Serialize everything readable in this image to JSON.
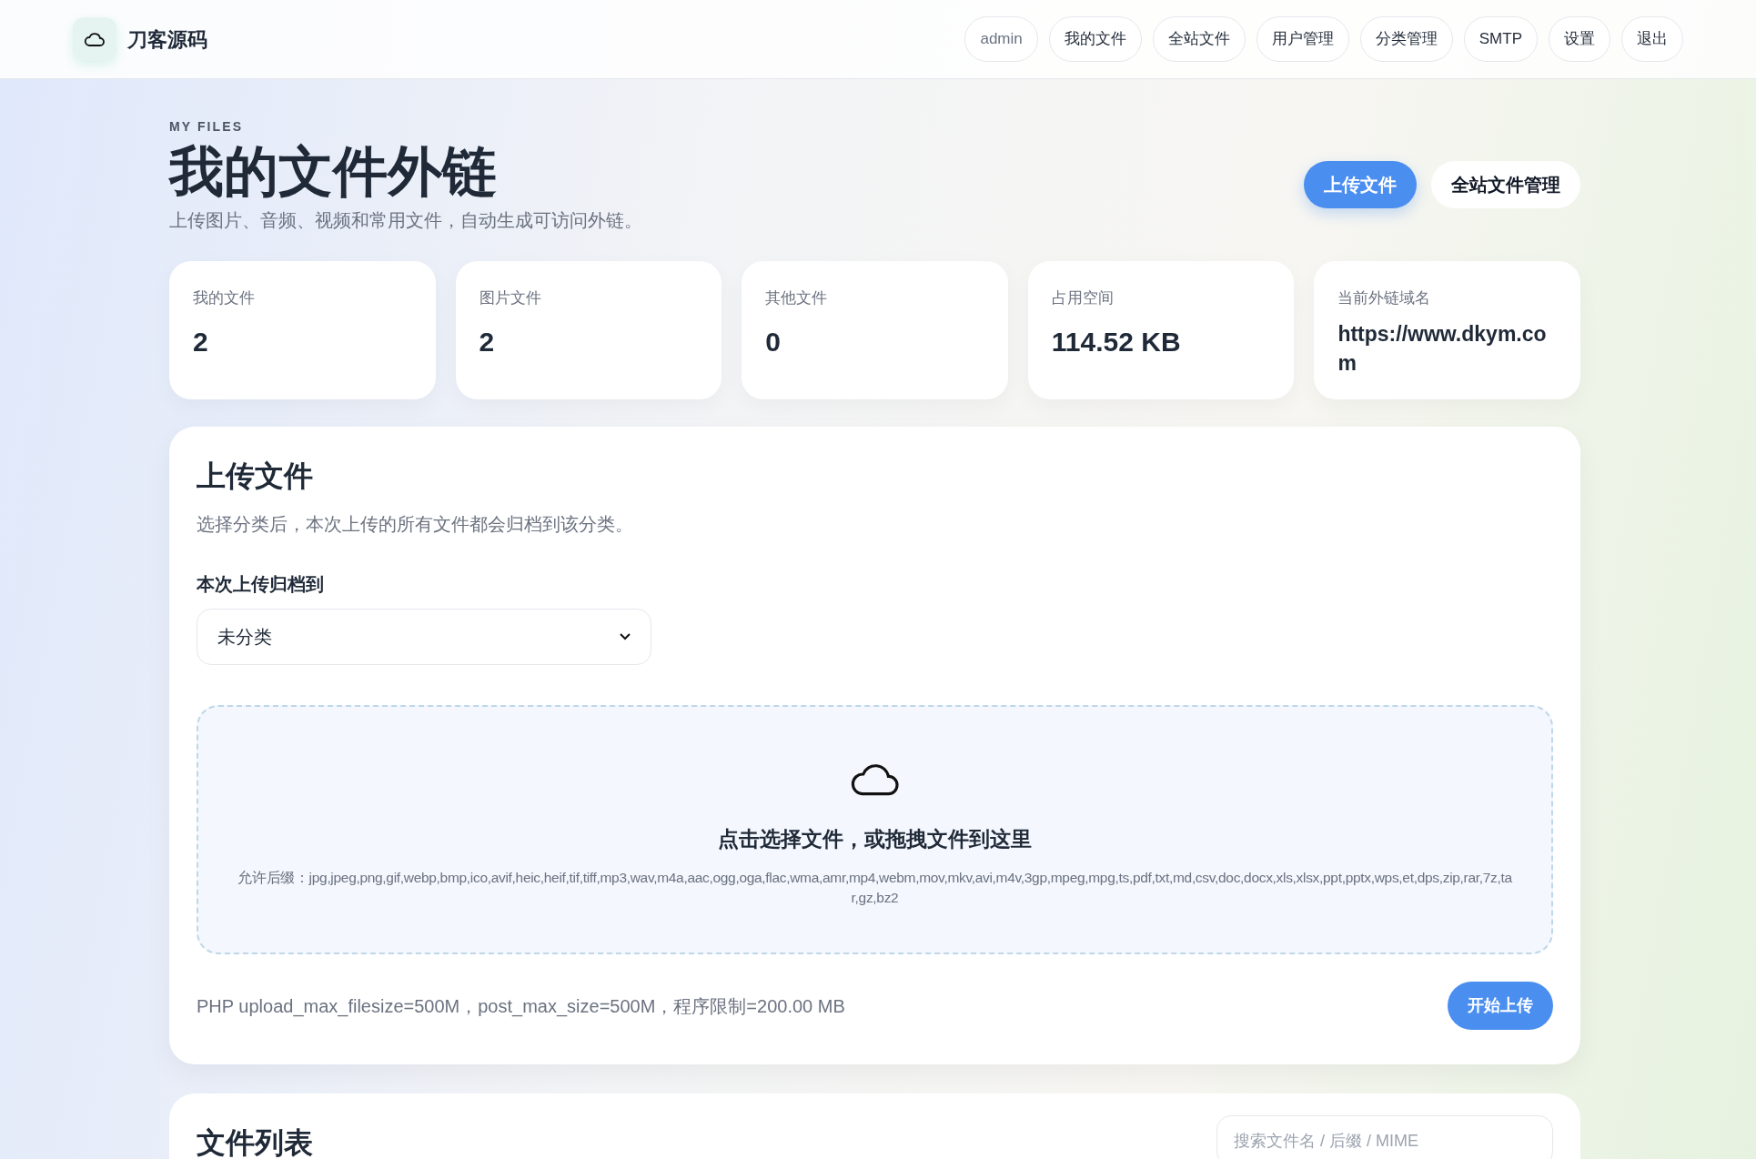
{
  "brand": {
    "name": "刀客源码"
  },
  "nav": [
    {
      "label": "admin",
      "kind": "user"
    },
    {
      "label": "我的文件",
      "kind": "link"
    },
    {
      "label": "全站文件",
      "kind": "link"
    },
    {
      "label": "用户管理",
      "kind": "link"
    },
    {
      "label": "分类管理",
      "kind": "link"
    },
    {
      "label": "SMTP",
      "kind": "link"
    },
    {
      "label": "设置",
      "kind": "link"
    },
    {
      "label": "退出",
      "kind": "link"
    }
  ],
  "hero": {
    "eyebrow": "MY FILES",
    "title": "我的文件外链",
    "subtitle": "上传图片、音频、视频和常用文件，自动生成可访问外链。",
    "actions": [
      {
        "label": "上传文件",
        "kind": "primary"
      },
      {
        "label": "全站文件管理",
        "kind": "secondary"
      }
    ]
  },
  "stats": [
    {
      "label": "我的文件",
      "value": "2"
    },
    {
      "label": "图片文件",
      "value": "2"
    },
    {
      "label": "其他文件",
      "value": "0"
    },
    {
      "label": "占用空间",
      "value": "114.52 KB"
    },
    {
      "label": "当前外链域名",
      "value": "https://www.dkym.com"
    }
  ],
  "upload": {
    "title": "上传文件",
    "description": "选择分类后，本次上传的所有文件都会归档到该分类。",
    "category_label": "本次上传归档到",
    "category_value": "未分类",
    "dropzone": {
      "title": "点击选择文件，或拖拽文件到这里",
      "allowed": "允许后缀：jpg,jpeg,png,gif,webp,bmp,ico,avif,heic,heif,tif,tiff,mp3,wav,m4a,aac,ogg,oga,flac,wma,amr,mp4,webm,mov,mkv,avi,m4v,3gp,mpeg,mpg,ts,pdf,txt,md,csv,doc,docx,xls,xlsx,ppt,pptx,wps,et,dps,zip,rar,7z,tar,gz,bz2"
    },
    "limits": "PHP upload_max_filesize=500M，post_max_size=500M，程序限制=200.00 MB",
    "submit": "开始上传"
  },
  "file_list": {
    "title": "文件列表",
    "search": {
      "placeholder": "搜索文件名 / 后缀 / MIME"
    }
  }
}
